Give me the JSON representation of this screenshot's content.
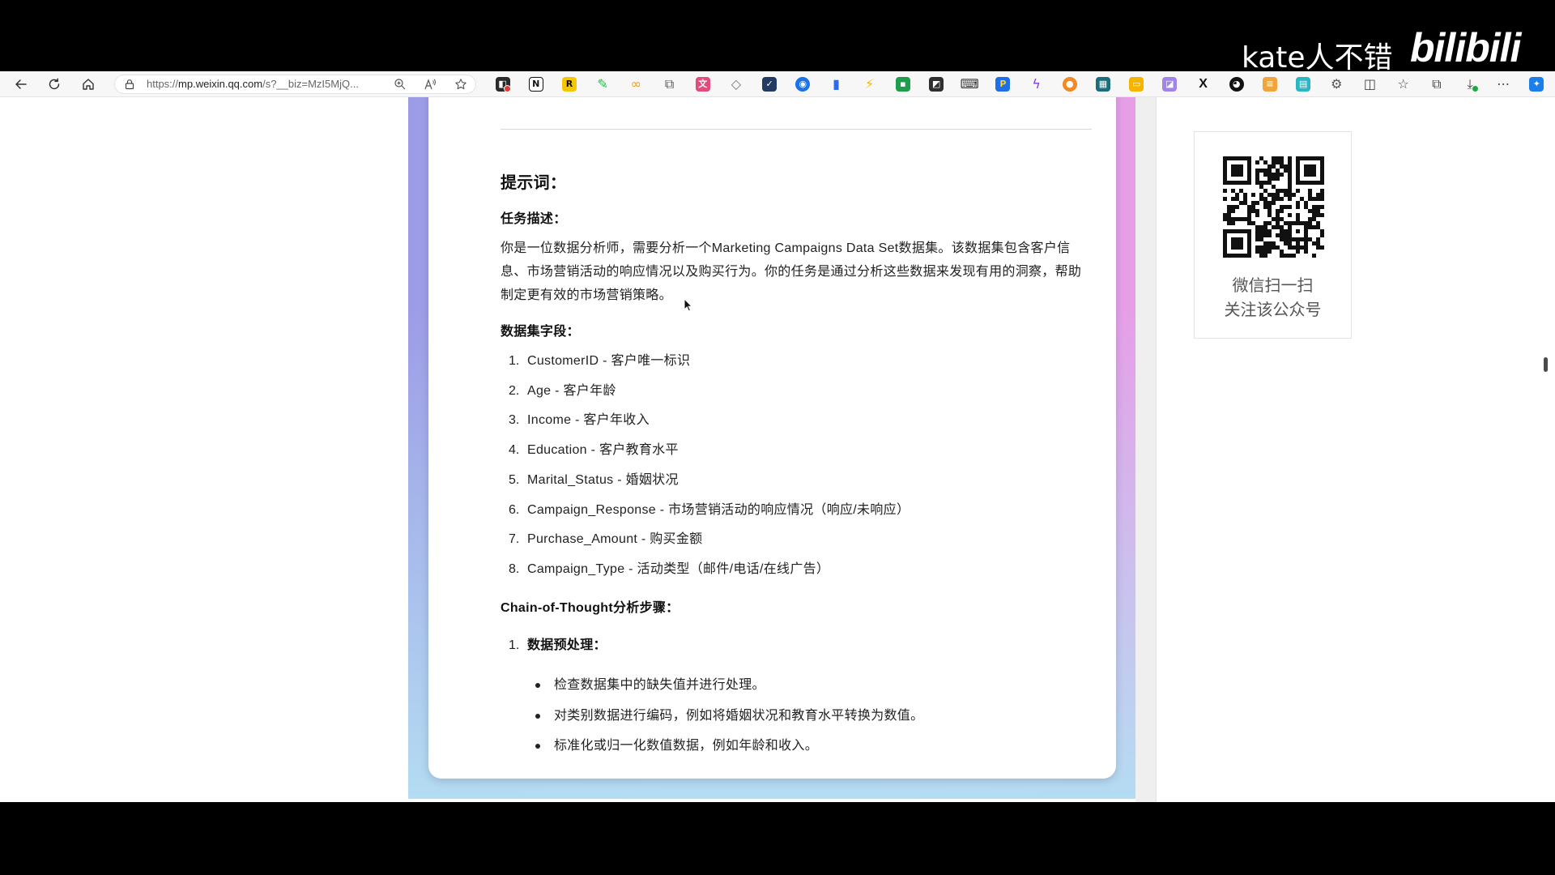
{
  "browser": {
    "url": {
      "scheme": "https://",
      "host": "mp.weixin.qq.com",
      "path": "/s?__biz=MzI5MjQ..."
    },
    "extensions": [
      {
        "icon": "extension-dark-badge-icon",
        "color": "#2b2b2b"
      },
      {
        "icon": "notion-icon",
        "color": "#111111"
      },
      {
        "icon": "r-extension-icon",
        "color": "#f6c700"
      },
      {
        "icon": "green-pen-icon",
        "color": "#2db84d"
      },
      {
        "icon": "orange-link-icon",
        "color": "#f39c12"
      },
      {
        "icon": "copy-icon",
        "color": "#555555"
      },
      {
        "icon": "translate-icon",
        "color": "#e14c7c"
      },
      {
        "icon": "shield-icon",
        "color": "#777777"
      },
      {
        "icon": "dark-square-icon",
        "color": "#233a63"
      },
      {
        "icon": "globe-icon",
        "color": "#1a73e8"
      },
      {
        "icon": "bar-chart-icon",
        "color": "#2c6bed"
      },
      {
        "icon": "lightning-icon",
        "color": "#f5b800"
      },
      {
        "icon": "green-square-icon",
        "color": "#1e9e4a"
      },
      {
        "icon": "dark-tile-icon",
        "color": "#2f2f2f"
      },
      {
        "icon": "keyboard-icon",
        "color": "#333333"
      },
      {
        "icon": "blue-yellow-icon",
        "color": "#1e6ee8"
      },
      {
        "icon": "purple-icon",
        "color": "#7b3fe4"
      },
      {
        "icon": "orange-circle-icon",
        "color": "#f08a24"
      },
      {
        "icon": "teal-square-icon",
        "color": "#196d7c"
      },
      {
        "icon": "yellow-folder-icon",
        "color": "#f4b400"
      },
      {
        "icon": "purple-square-icon",
        "color": "#a084e8"
      },
      {
        "icon": "x-icon",
        "color": "#111111"
      },
      {
        "icon": "github-icon",
        "color": "#111111"
      },
      {
        "icon": "orange-note-icon",
        "color": "#f2a33a"
      },
      {
        "icon": "cyan-square-icon",
        "color": "#2cb5c3"
      },
      {
        "icon": "extensions-icon",
        "color": "#555555"
      },
      {
        "icon": "split-screen-icon",
        "color": "#444444"
      },
      {
        "icon": "favorites-icon",
        "color": "#444444"
      },
      {
        "icon": "collections-icon",
        "color": "#444444"
      },
      {
        "icon": "downloads-icon",
        "color": "#444444"
      },
      {
        "icon": "more-icon",
        "color": "#444444"
      },
      {
        "icon": "copilot-icon",
        "color": "#1a7fe8"
      }
    ]
  },
  "watermark": {
    "uploader": "kate人不错",
    "logo": "bilibili"
  },
  "theme": {
    "frame_left": "#9c9be6",
    "frame_mid": "#c6c3f1",
    "frame_right": "#e79ee7",
    "frame_bottom": "#b4dcf2"
  },
  "article": {
    "heading": "提示词：",
    "task": {
      "label": "任务描述：",
      "lines": [
        "你是一位数据分析师，需要分析一个Marketing Campaigns Data Set数据集。该数据集包含客户信",
        "息、市场营销活动的响应情况以及购买行为。你的任务是通过分析这些数据来发现有用的洞察，帮助",
        "制定更有效的市场营销策略。"
      ]
    },
    "fields": {
      "label": "数据集字段：",
      "items": [
        {
          "num": "1.",
          "text": "CustomerID - 客户唯一标识"
        },
        {
          "num": "2.",
          "text": "Age - 客户年龄"
        },
        {
          "num": "3.",
          "text": "Income - 客户年收入"
        },
        {
          "num": "4.",
          "text": "Education - 客户教育水平"
        },
        {
          "num": "5.",
          "text": "Marital_Status - 婚姻状况"
        },
        {
          "num": "6.",
          "text": "Campaign_Response - 市场营销活动的响应情况（响应/未响应）"
        },
        {
          "num": "7.",
          "text": "Purchase_Amount - 购买金额"
        },
        {
          "num": "8.",
          "text": "Campaign_Type - 活动类型（邮件/电话/在线广告）"
        }
      ]
    },
    "cot": {
      "label": "Chain-of-Thought分析步骤：",
      "steps": [
        {
          "num": "1.",
          "title": "数据预处理：",
          "bullets": [
            "检查数据集中的缺失值并进行处理。",
            "对类别数据进行编码，例如将婚姻状况和教育水平转换为数值。",
            "标准化或归一化数值数据，例如年龄和收入。"
          ]
        }
      ]
    }
  },
  "sidebar": {
    "qr": {
      "caption_line1": "微信扫一扫",
      "caption_line2": "关注该公众号"
    }
  }
}
